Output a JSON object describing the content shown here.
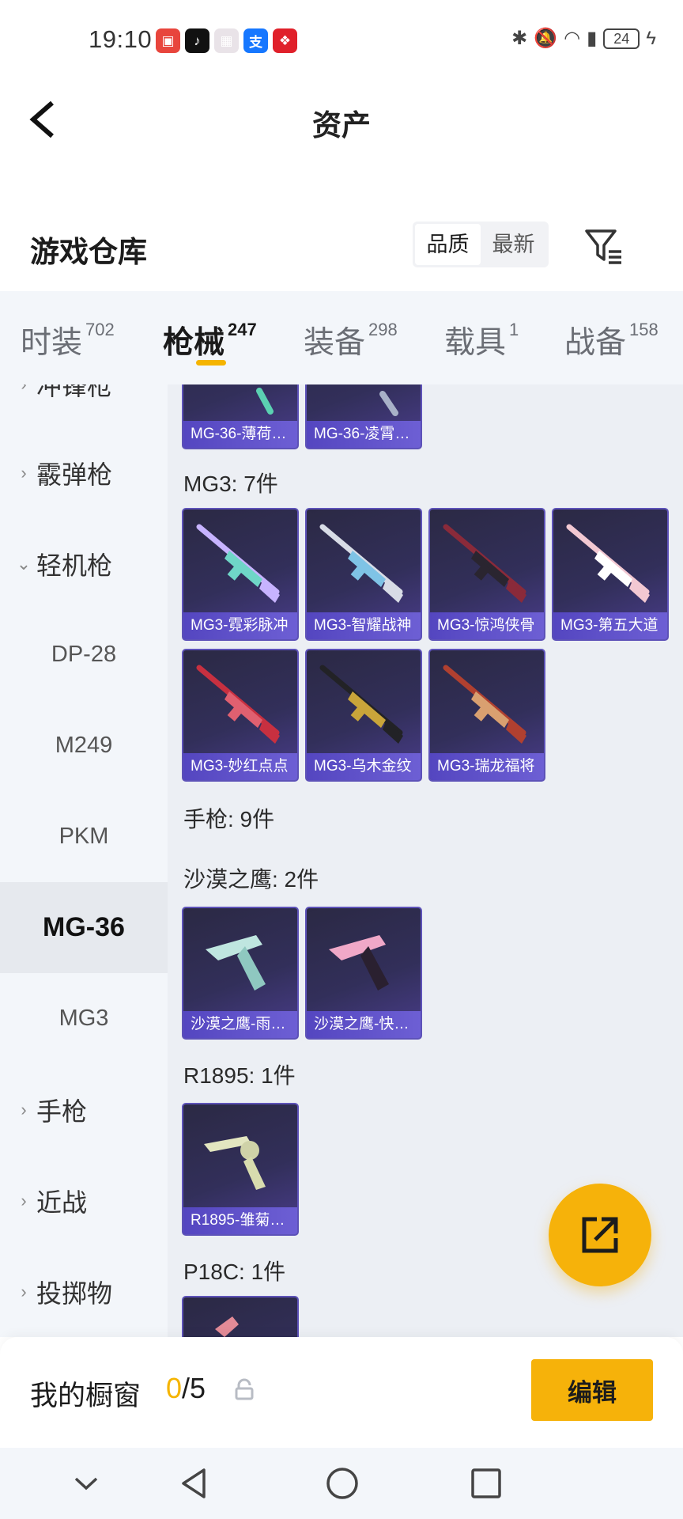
{
  "status_bar": {
    "time": "19:10",
    "app_icons": [
      {
        "name": "huawei-mall-icon",
        "color": "#e8453c",
        "glyph": "▣"
      },
      {
        "name": "tiktok-icon",
        "color": "#111111",
        "glyph": "♪"
      },
      {
        "name": "gift-box-icon",
        "color": "#e9e3e8",
        "glyph": "▦"
      },
      {
        "name": "alipay-icon",
        "color": "#1677ff",
        "glyph": "支"
      },
      {
        "name": "red-app-icon",
        "color": "#e0202a",
        "glyph": "❖"
      }
    ],
    "battery": "24"
  },
  "nav": {
    "title": "资产"
  },
  "warehouse": {
    "title": "游戏仓库",
    "sort_options": [
      "品质",
      "最新"
    ],
    "active_sort": "品质"
  },
  "category_tabs": [
    {
      "label": "时装",
      "count": "702",
      "active": false
    },
    {
      "label": "枪械",
      "count": "247",
      "active": true
    },
    {
      "label": "装备",
      "count": "298",
      "active": false
    },
    {
      "label": "载具",
      "count": "1",
      "active": false
    },
    {
      "label": "战备",
      "count": "158",
      "active": false
    }
  ],
  "sidebar": [
    {
      "label": "冲锋枪",
      "type": "parent",
      "expanded": false
    },
    {
      "label": "霰弹枪",
      "type": "parent",
      "expanded": false
    },
    {
      "label": "轻机枪",
      "type": "parent",
      "expanded": true
    },
    {
      "label": "DP-28",
      "type": "child"
    },
    {
      "label": "M249",
      "type": "child"
    },
    {
      "label": "PKM",
      "type": "child"
    },
    {
      "label": "MG-36",
      "type": "child",
      "selected": true
    },
    {
      "label": "MG3",
      "type": "child"
    },
    {
      "label": "手枪",
      "type": "parent",
      "expanded": false
    },
    {
      "label": "近战",
      "type": "parent",
      "expanded": false
    },
    {
      "label": "投掷物",
      "type": "parent",
      "expanded": false
    }
  ],
  "content": {
    "mg36_partial": [
      "MG-36-薄荷…",
      "MG-36-凌霄…"
    ],
    "mg3_header": "MG3: 7件",
    "mg3_items": [
      "MG3-霓彩脉冲",
      "MG3-智耀战神",
      "MG3-惊鸿侠骨",
      "MG3-第五大道",
      "MG3-妙红点点",
      "MG3-乌木金纹",
      "MG3-瑞龙福将"
    ],
    "pistol_header": "手枪: 9件",
    "deagle_header": "沙漠之鹰: 2件",
    "deagle_items": [
      "沙漠之鹰-雨…",
      "沙漠之鹰-快…"
    ],
    "r1895_header": "R1895: 1件",
    "r1895_items": [
      "R1895-雏菊…"
    ],
    "p18c_header": "P18C: 1件"
  },
  "showcase": {
    "label": "我的橱窗",
    "current": "0",
    "total": "/5",
    "edit_label": "编辑"
  },
  "colors": {
    "accent": "#f6b20a",
    "card_label": "#5d4fc8",
    "sidebar_bg": "#f3f6fa",
    "content_bg": "#eceff4"
  }
}
